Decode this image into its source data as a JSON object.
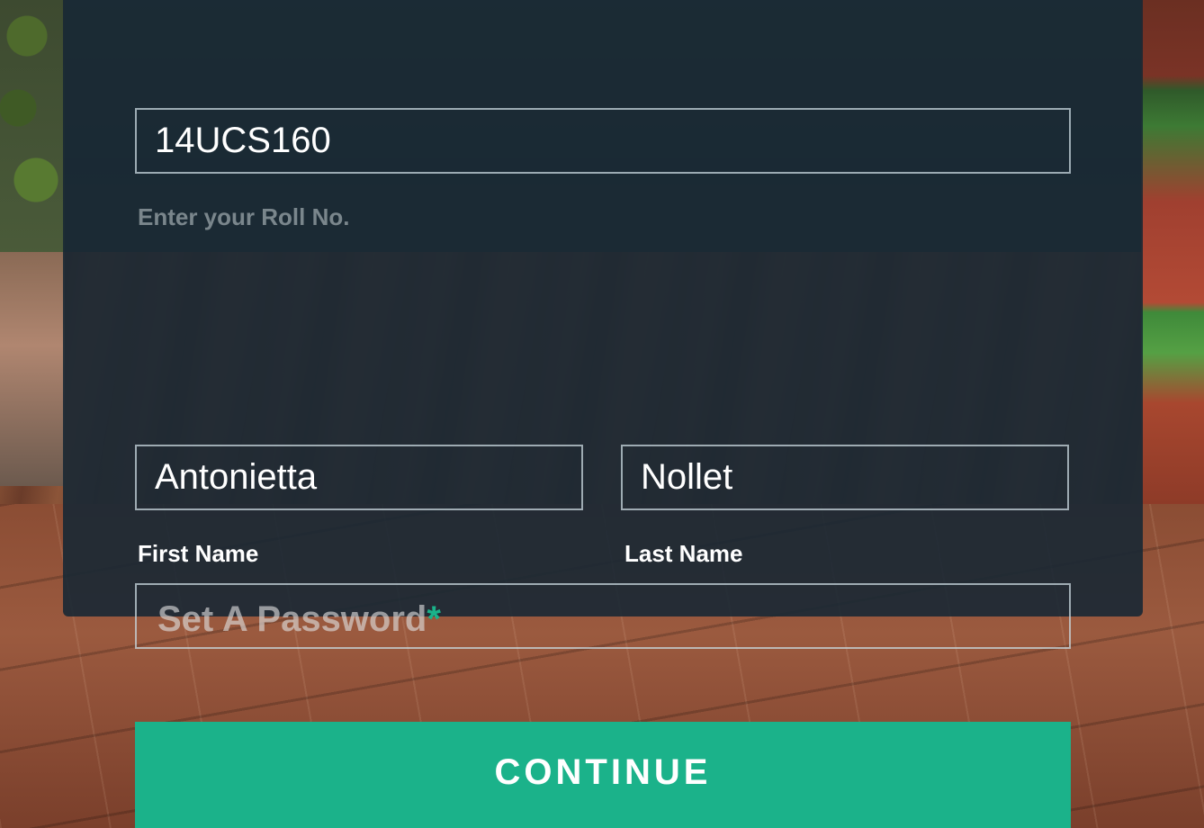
{
  "form": {
    "roll_no": {
      "value": "14UCS160",
      "helper": "Enter your Roll No."
    },
    "first_name": {
      "value": "Antonietta",
      "label": "First Name"
    },
    "last_name": {
      "value": "Nollet",
      "label": "Last Name"
    },
    "password": {
      "placeholder": "Set A Password",
      "required_marker": "*",
      "value": ""
    },
    "continue_label": "CONTINUE"
  },
  "colors": {
    "accent": "#1bb28a",
    "panel": "#18283a",
    "input_border": "#c8d7de"
  }
}
